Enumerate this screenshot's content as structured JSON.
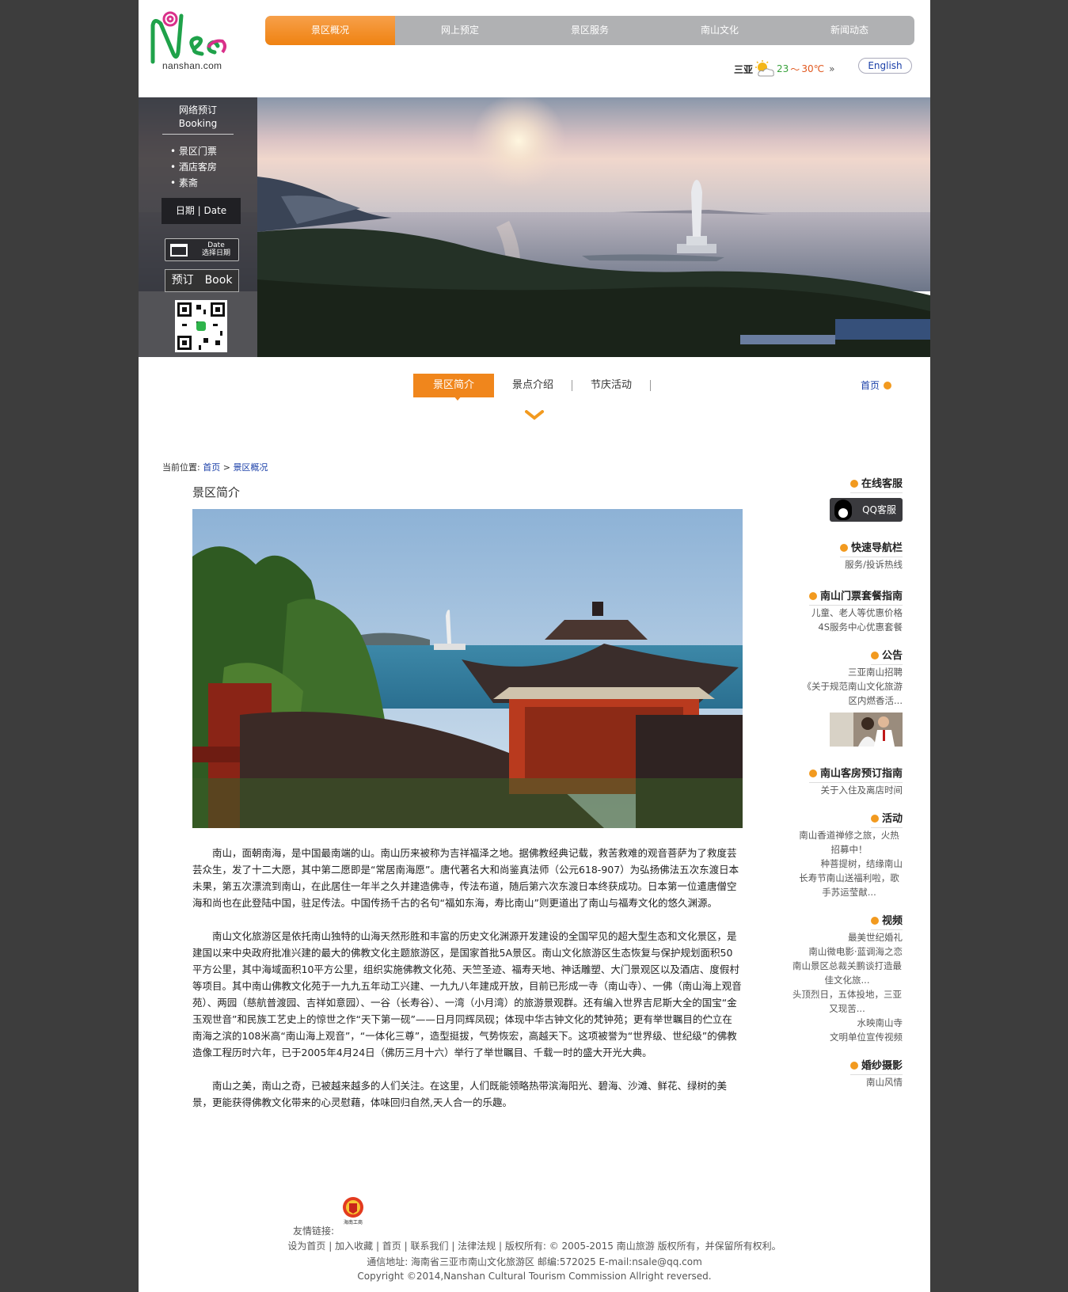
{
  "header": {
    "logo_text": "nanshan.com",
    "nav": [
      "景区概况",
      "网上预定",
      "景区服务",
      "南山文化",
      "新闻动态"
    ],
    "weather": {
      "city": "三亚",
      "low": "23",
      "separator": "～",
      "high": "30℃",
      "more": "»"
    },
    "language_button": "English"
  },
  "booking": {
    "title_cn": "网络预订",
    "title_en": "Booking",
    "items": [
      "景区门票",
      "酒店客房",
      "素斋"
    ],
    "date_label": "日期 | Date",
    "date_button_en": "Date",
    "date_button_cn": "选择日期",
    "book_button": "预订　Book"
  },
  "subnav": {
    "tabs": [
      "景区简介",
      "景点介绍",
      "节庆活动"
    ],
    "home": "首页"
  },
  "breadcrumb": {
    "label": "当前位置:",
    "home": "首页",
    "sep": ">",
    "current": "景区概况"
  },
  "content": {
    "title": "景区简介",
    "paragraphs": [
      "南山，面朝南海，是中国最南端的山。南山历来被称为吉祥福泽之地。据佛教经典记载，救苦救难的观音菩萨为了救度芸芸众生，发了十二大愿，其中第二愿即是“常居南海愿”。唐代著名大和尚鉴真法师（公元618-907）为弘扬佛法五次东渡日本未果，第五次漂流到南山，在此居住一年半之久并建造佛寺，传法布道，随后第六次东渡日本终获成功。日本第一位遣唐僧空海和尚也在此登陆中国，驻足传法。中国传扬千古的名句“福如东海，寿比南山”则更道出了南山与福寿文化的悠久渊源。",
      "南山文化旅游区是依托南山独特的山海天然形胜和丰富的历史文化渊源开发建设的全国罕见的超大型生态和文化景区，是建国以来中央政府批准兴建的最大的佛教文化主题旅游区，是国家首批5A景区。南山文化旅游区生态恢复与保护规划面积50平方公里，其中海域面积10平方公里，组织实施佛教文化苑、天竺圣迹、福寿天地、神话雕塑、大门景观区以及酒店、度假村等项目。其中南山佛教文化苑于一九九五年动工兴建、一九九八年建成开放，目前已形成一寺（南山寺）、一佛（南山海上观音苑）、两园（慈航普渡园、吉祥如意园）、一谷（长寿谷）、一湾（小月湾）的旅游景观群。还有编入世界吉尼斯大全的国宝“金玉观世音”和民族工艺史上的惊世之作“天下第一砚”——日月同辉凤砚；体现中华古钟文化的梵钟苑；更有举世瞩目的伫立在南海之滨的108米高“南山海上观音”，“一体化三尊”，造型挺拔，气势恢宏，高越天下。这项被誉为“世界级、世纪级”的佛教造像工程历时六年，已于2005年4月24日（佛历三月十六）举行了举世瞩目、千载一时的盛大开光大典。",
      "南山之美，南山之奇，已被越来越多的人们关注。在这里，人们既能领略热带滨海阳光、碧海、沙滩、鲜花、绿树的美景，更能获得佛教文化带来的心灵慰藉，体味回归自然,天人合一的乐趣。"
    ]
  },
  "sidebar": {
    "online": {
      "title": "在线客服",
      "qq": "QQ客服"
    },
    "quicknav": {
      "title": "快速导航栏",
      "links": [
        "服务/投诉热线"
      ]
    },
    "tickets": {
      "title": "南山门票套餐指南",
      "links": [
        "儿童、老人等优惠价格",
        "4S服务中心优惠套餐"
      ]
    },
    "notice": {
      "title": "公告",
      "links": [
        "三亚南山招聘",
        "《关于规范南山文化旅游区内燃香活..."
      ]
    },
    "rooms": {
      "title": "南山客房预订指南",
      "links": [
        "关于入住及离店时间"
      ]
    },
    "events": {
      "title": "活动",
      "links": [
        "南山香道禅修之旅，火热招募中！",
        "种菩提树，结缘南山",
        "长寿节南山送福利啦，歌手苏运莹献..."
      ]
    },
    "video": {
      "title": "视频",
      "links": [
        "最美世纪婚礼",
        "南山微电影·蓝调海之恋",
        "南山景区总裁关鹏谈打造最佳文化旅...",
        "头顶烈日，五体投地，三亚又现苦...",
        "水映南山寺",
        "文明单位宣传视频"
      ]
    },
    "wedding": {
      "title": "婚纱摄影",
      "links": [
        "南山风情"
      ]
    }
  },
  "footer": {
    "friend_label": "友情链接:",
    "badge_text": "海南工商",
    "links": [
      "设为首页",
      "加入收藏",
      "首页",
      "联系我们",
      "法律法规"
    ],
    "copyright_cn": "版权所有: © 2005-2015 南山旅游 版权所有，并保留所有权利。",
    "address": "通信地址: 海南省三亚市南山文化旅游区 邮编:572025 E-mail:nsale@qq.com",
    "copyright_en": "Copyright ©2014,Nanshan Cultural Tourism Commission Allright reversed."
  },
  "colors": {
    "accent": "#f0861c",
    "nav_gray": "#b0b1b3",
    "link_blue": "#1a3fa8",
    "page_bg": "#3d3d3d"
  }
}
